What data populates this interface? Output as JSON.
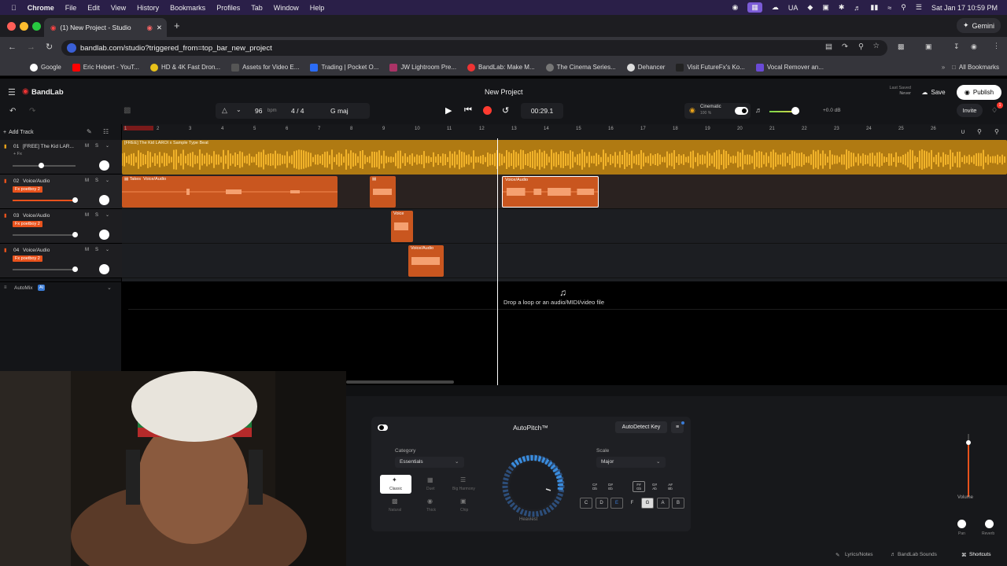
{
  "macos": {
    "app": "Chrome",
    "menus": [
      "File",
      "Edit",
      "View",
      "History",
      "Bookmarks",
      "Profiles",
      "Tab",
      "Window",
      "Help"
    ],
    "keyboard": "UA",
    "clock": "Sat Jan 17  10:59 PM"
  },
  "browser": {
    "tab_title": "(1) New Project - Studio",
    "new_tab": "+",
    "gemini": "Gemini",
    "url": "bandlab.com/studio?triggered_from=top_bar_new_project",
    "bookmarks": [
      "Google",
      "Eric Hebert - YouT...",
      "HD & 4K Fast Dron...",
      "Assets for Video E...",
      "Trading | Pocket O...",
      "JW Lightroom Pre...",
      "BandLab: Make M...",
      "The Cinema Series...",
      "Dehancer",
      "Visit FutureFx's Ko...",
      "Vocal Remover an..."
    ],
    "all_bookmarks": "All Bookmarks"
  },
  "studio": {
    "logo": "BandLab",
    "project_title": "New Project",
    "last_saved_label": "Last Saved",
    "last_saved_value": "Never",
    "save": "Save",
    "publish": "Publish",
    "invite": "Invite",
    "tempo": "96",
    "tempo_unit": "bpm",
    "time_sig": "4 / 4",
    "key": "G maj",
    "time": "00:29.1",
    "preset_name": "Cinematic",
    "preset_value": "100 %",
    "master_db": "+0.0 dB",
    "notification_count": "1"
  },
  "ruler": [
    "1",
    "2",
    "3",
    "4",
    "5",
    "6",
    "7",
    "8",
    "9",
    "10",
    "11",
    "12",
    "13",
    "14",
    "15",
    "16",
    "17",
    "18",
    "19",
    "20",
    "21",
    "22",
    "23",
    "24",
    "25",
    "26"
  ],
  "tracks": [
    {
      "num": "01",
      "name": "[FREE] The Kid LAR...",
      "fx": "+ Fx",
      "fx_active": false,
      "clip_label": "[FREE] The Kid LAROI x Sample Type Beat"
    },
    {
      "num": "02",
      "name": "Voice/Audio",
      "fx": "Fx poetboy 2",
      "fx_active": true
    },
    {
      "num": "03",
      "name": "Voice/Audio",
      "fx": "Fx poetboy 2",
      "fx_active": true
    },
    {
      "num": "04",
      "name": "Voice/Audio",
      "fx": "Fx poetboy 2",
      "fx_active": true
    }
  ],
  "clip_labels": {
    "takes": "Takes",
    "voice": "Voice/Audio",
    "voice_short": "Voice"
  },
  "add_track": "Add Track",
  "automix": "AutoMix",
  "automix_badge": "AI",
  "drop_hint": "Drop a loop or an audio/MIDI/video file",
  "autopitch": {
    "title": "AutoPitch™",
    "autodetect": "AutoDetect Key",
    "category_label": "Category",
    "category_value": "Essentials",
    "scale_label": "Scale",
    "scale_value": "Major",
    "styles": [
      "Classic",
      "Duet",
      "Big Harmony",
      "Natural",
      "Thick",
      "Chip"
    ],
    "knob_label": "Heaviest",
    "sharp_keys": [
      "C#\nDb",
      "D#\nEb",
      "F#\nGb",
      "G#\nAb",
      "A#\nBb"
    ],
    "keys": [
      "C",
      "D",
      "E",
      "F",
      "G",
      "A",
      "B"
    ],
    "volume": "Volume",
    "pan": "Pan",
    "reverb": "Reverb"
  },
  "footer": {
    "lyrics": "Lyrics/Notes",
    "sounds": "BandLab Sounds",
    "shortcuts": "Shortcuts"
  },
  "colors": {
    "beat": "#e8a21a",
    "vocal": "#d9531d",
    "accent": "#e8521c",
    "record": "#ff3b30"
  }
}
